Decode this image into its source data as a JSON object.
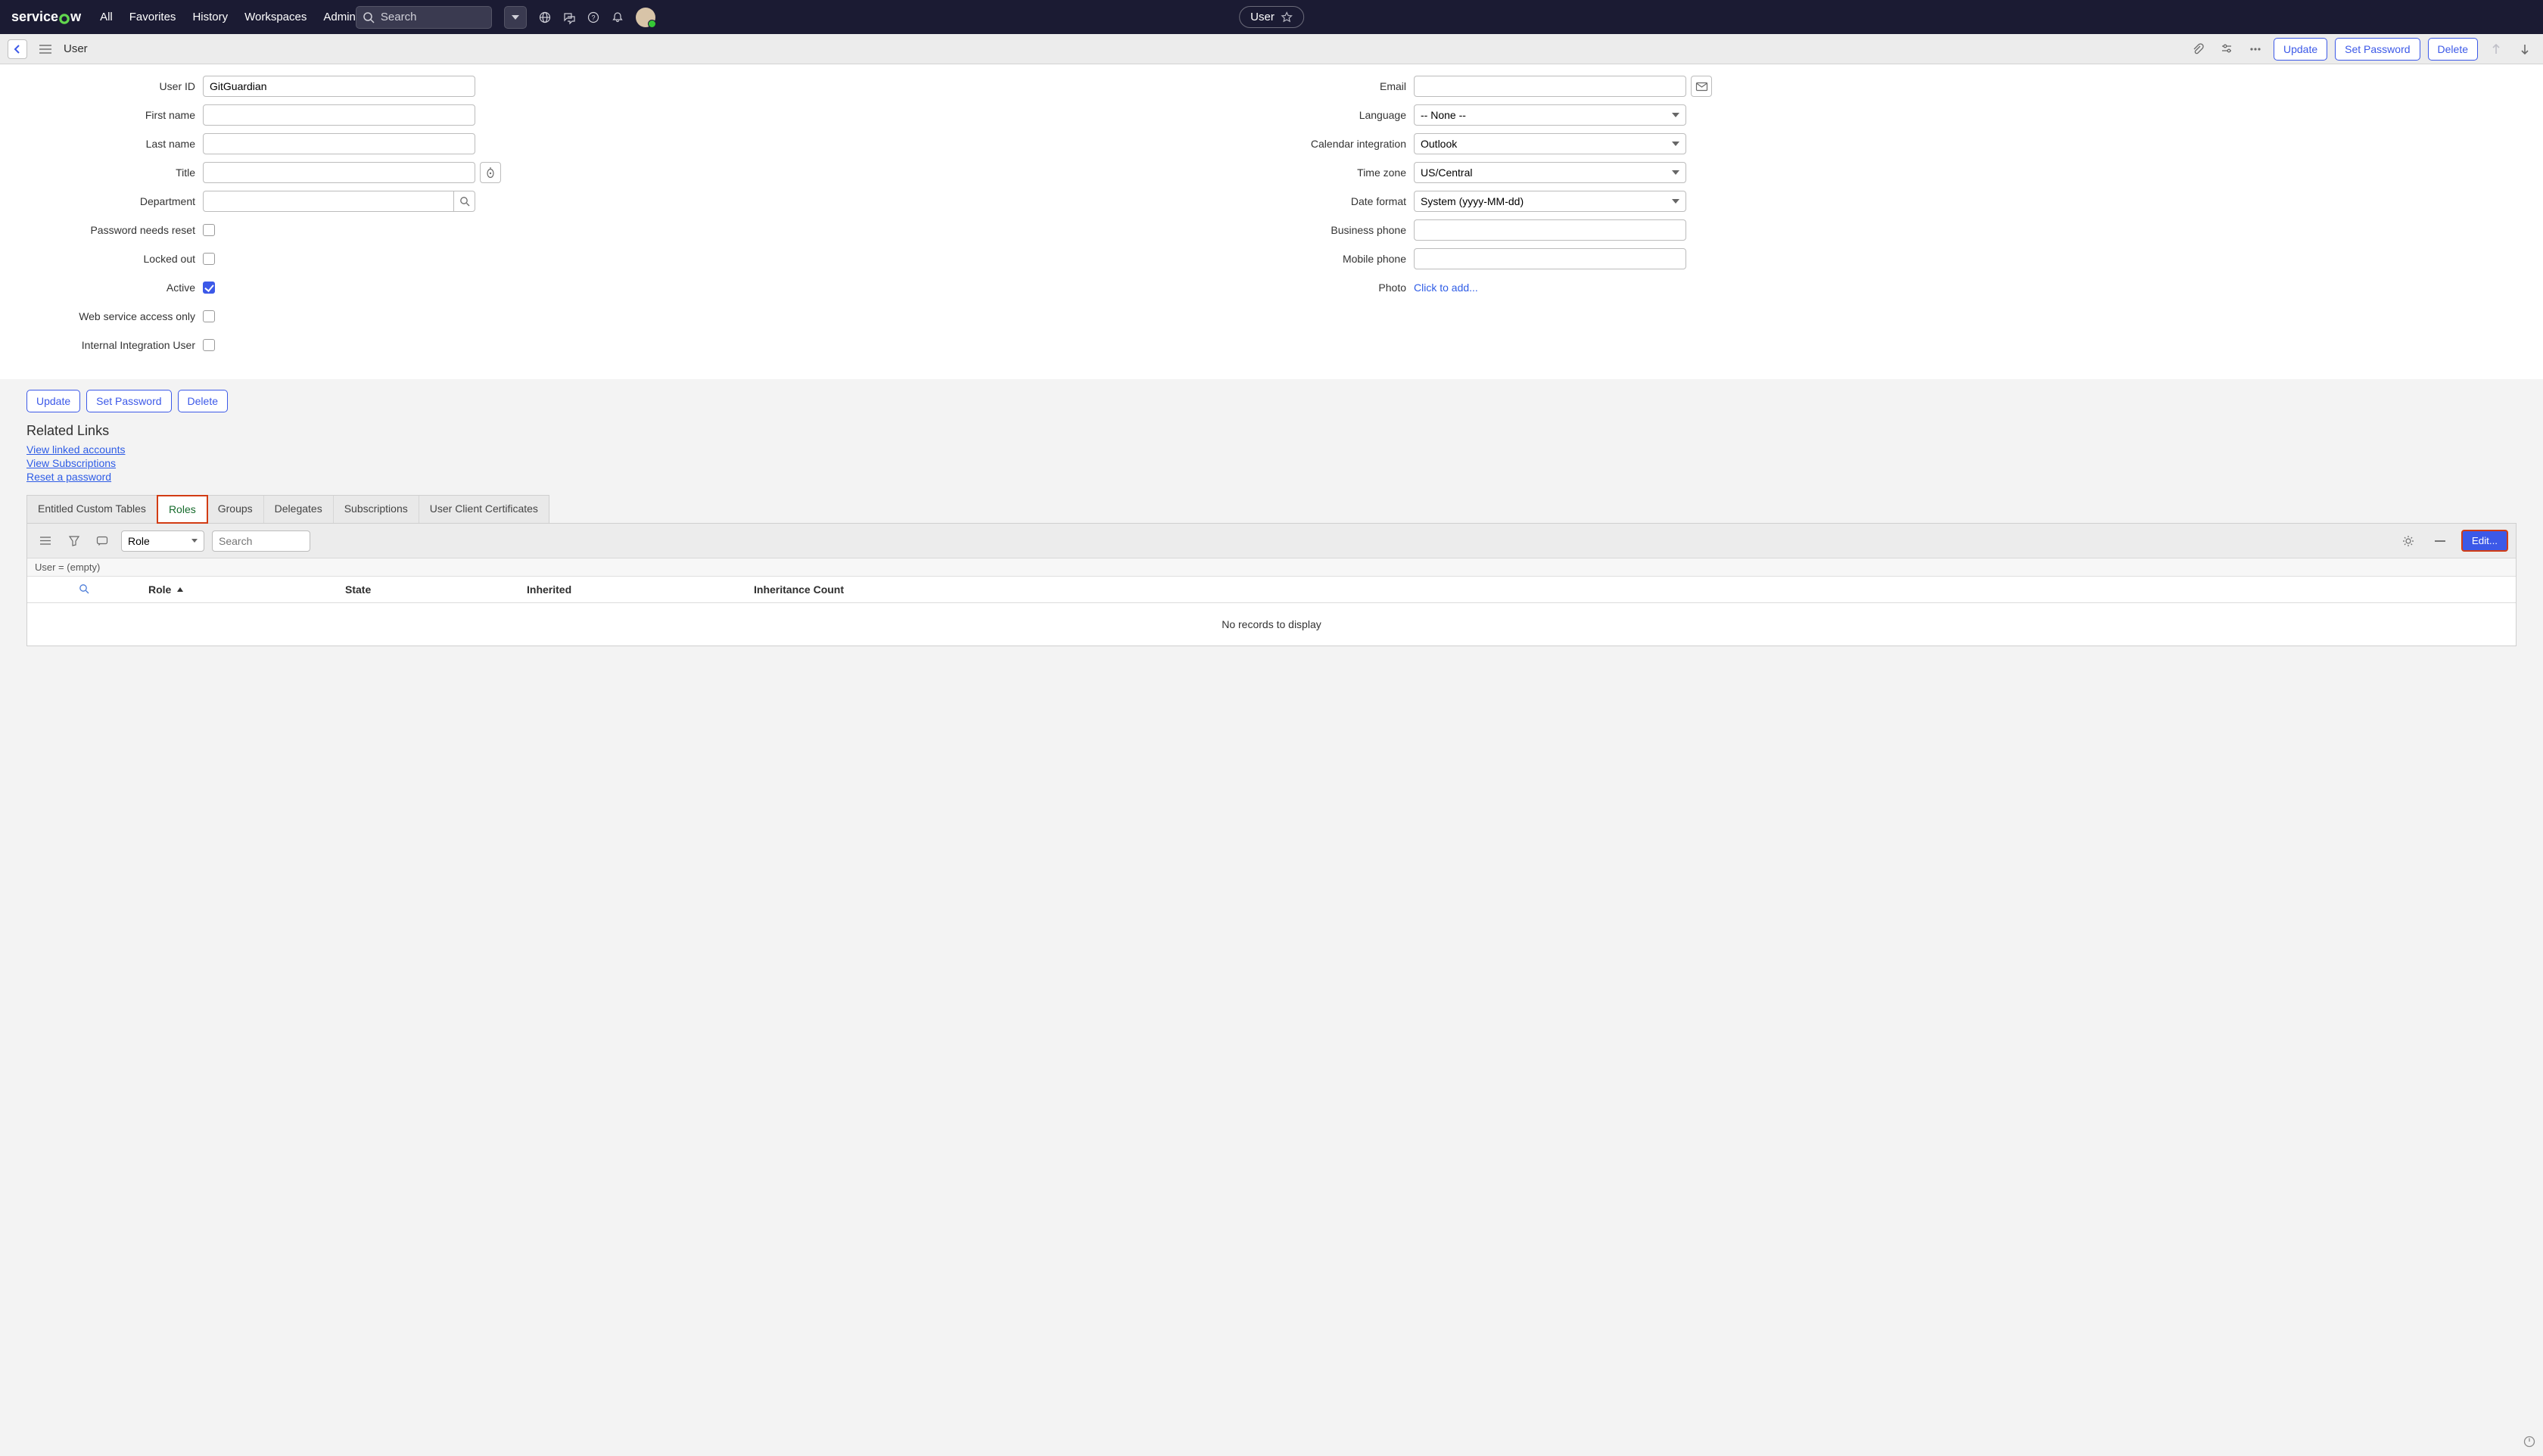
{
  "topnav": {
    "logo_pre": "service",
    "logo_post": "w",
    "links": [
      "All",
      "Favorites",
      "History",
      "Workspaces",
      "Admin"
    ],
    "center_pill": "User",
    "search_placeholder": "Search"
  },
  "subheader": {
    "title": "User",
    "actions": {
      "update": "Update",
      "set_password": "Set Password",
      "delete": "Delete"
    }
  },
  "form": {
    "left": {
      "user_id": {
        "label": "User ID",
        "value": "GitGuardian"
      },
      "first_name": {
        "label": "First name",
        "value": ""
      },
      "last_name": {
        "label": "Last name",
        "value": ""
      },
      "title": {
        "label": "Title",
        "value": ""
      },
      "department": {
        "label": "Department",
        "value": ""
      },
      "password_needs_reset": {
        "label": "Password needs reset",
        "checked": false
      },
      "locked_out": {
        "label": "Locked out",
        "checked": false
      },
      "active": {
        "label": "Active",
        "checked": true
      },
      "web_service": {
        "label": "Web service access only",
        "checked": false
      },
      "internal_integration": {
        "label": "Internal Integration User",
        "checked": false
      }
    },
    "right": {
      "email": {
        "label": "Email",
        "value": ""
      },
      "language": {
        "label": "Language",
        "value": "-- None --"
      },
      "calendar": {
        "label": "Calendar integration",
        "value": "Outlook"
      },
      "timezone": {
        "label": "Time zone",
        "value": "US/Central"
      },
      "date_format": {
        "label": "Date format",
        "value": "System (yyyy-MM-dd)"
      },
      "business_phone": {
        "label": "Business phone",
        "value": ""
      },
      "mobile_phone": {
        "label": "Mobile phone",
        "value": ""
      },
      "photo": {
        "label": "Photo",
        "link": "Click to add..."
      }
    }
  },
  "below": {
    "buttons": {
      "update": "Update",
      "set_password": "Set Password",
      "delete": "Delete"
    },
    "related_heading": "Related Links",
    "related_links": [
      "View linked accounts",
      "View Subscriptions",
      "Reset a password"
    ]
  },
  "tabs": [
    "Entitled Custom Tables",
    "Roles",
    "Groups",
    "Delegates",
    "Subscriptions",
    "User Client Certificates"
  ],
  "selected_tab": "Roles",
  "roles": {
    "select_label": "Role",
    "search_placeholder": "Search",
    "edit_label": "Edit...",
    "filter_text": "User = (empty)",
    "columns": {
      "role": "Role",
      "state": "State",
      "inherited": "Inherited",
      "inheritance_count": "Inheritance Count"
    },
    "empty": "No records to display"
  }
}
